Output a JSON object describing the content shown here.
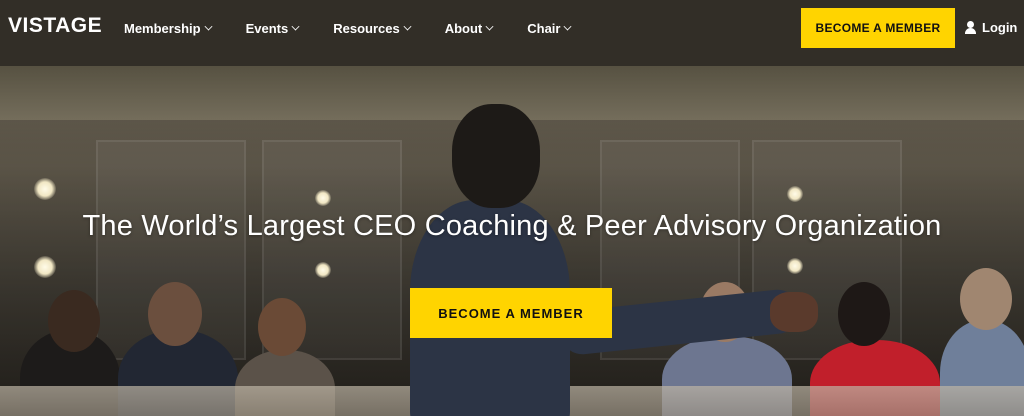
{
  "brand": {
    "logo_text": "VISTAGE"
  },
  "nav": {
    "items": [
      {
        "label": "Membership"
      },
      {
        "label": "Events"
      },
      {
        "label": "Resources"
      },
      {
        "label": "About"
      },
      {
        "label": "Chair"
      }
    ],
    "cta_label": "BECOME A MEMBER",
    "login_label": "Login"
  },
  "hero": {
    "title": "The World’s Largest CEO Coaching & Peer Advisory Organization",
    "cta_label": "BECOME A MEMBER"
  },
  "colors": {
    "accent": "#ffd400",
    "nav_text": "#ffffff",
    "cta_text": "#111111"
  },
  "icons": {
    "menu_dropdown": "chevron-down-icon",
    "login": "user-icon"
  }
}
